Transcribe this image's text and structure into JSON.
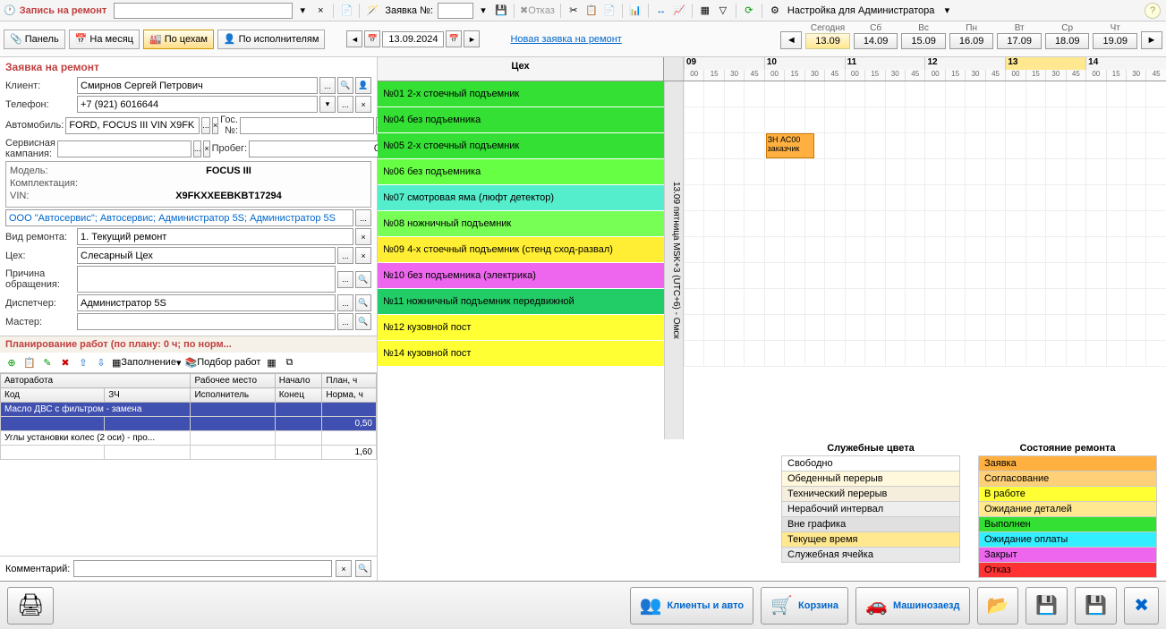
{
  "app": {
    "title": "Запись на ремонт"
  },
  "toolbar": {
    "request_label": "Заявка №:",
    "refusal": "Отказ",
    "admin_setting": "Настройка для Администратора"
  },
  "tabs": {
    "panel": "Панель",
    "month": "На месяц",
    "workshops": "По цехам",
    "performers": "По исполнителям"
  },
  "date_nav": {
    "date": "13.09.2024"
  },
  "new_request_link": "Новая заявка на ремонт",
  "week": {
    "today_label": "Сегодня",
    "days": [
      {
        "label": "Сегодня",
        "date": "13.09",
        "today": true
      },
      {
        "label": "Сб",
        "date": "14.09"
      },
      {
        "label": "Вс",
        "date": "15.09"
      },
      {
        "label": "Пн",
        "date": "16.09"
      },
      {
        "label": "Вт",
        "date": "17.09"
      },
      {
        "label": "Ср",
        "date": "18.09"
      },
      {
        "label": "Чт",
        "date": "19.09"
      }
    ]
  },
  "form": {
    "section_title": "Заявка на ремонт",
    "client_label": "Клиент:",
    "client": "Смирнов Сергей Петрович",
    "phone_label": "Телефон:",
    "phone": "+7 (921) 6016644",
    "auto_label": "Автомобиль:",
    "auto": "FORD, FOCUS III VIN X9FK",
    "gosno_label": "Гос. №:",
    "gosno": "",
    "campaign_label": "Сервисная кампания:",
    "campaign": "",
    "mileage_label": "Пробег:",
    "mileage": "0",
    "model_label": "Модель:",
    "model": "FOCUS III",
    "equip_label": "Комплектация:",
    "vin_label": "VIN:",
    "vin": "X9FKXXEEBKBT17294",
    "org": "ООО \"Автосервис\"; Автосервис; Администратор 5S; Администратор 5S",
    "repair_type_label": "Вид ремонта:",
    "repair_type": "1. Текущий ремонт",
    "workshop_label": "Цех:",
    "workshop": "Слесарный Цех",
    "reason_label": "Причина обращения:",
    "reason": "",
    "dispatcher_label": "Диспетчер:",
    "dispatcher": "Администратор 5S",
    "master_label": "Мастер:",
    "master": ""
  },
  "planning": {
    "header": "Планирование работ   (по плану: 0 ч; по норм...",
    "fill_label": "Заполнение",
    "selection_label": "Подбор работ",
    "columns": {
      "work": "Авторабота",
      "place": "Рабочее место",
      "start": "Начало",
      "plan": "План, ч",
      "code": "Код",
      "zch": "ЗЧ",
      "performer": "Исполнитель",
      "end": "Конец",
      "norm": "Норма, ч"
    },
    "rows": [
      {
        "name": "Масло ДВС с фильтром - замена",
        "norm": "0,50",
        "selected": true
      },
      {
        "name": "Углы установки колес (2 оси) - про...",
        "norm": "1,60",
        "selected": false
      }
    ]
  },
  "comment": {
    "label": "Комментарий:",
    "value": ""
  },
  "schedule": {
    "header": "Цех",
    "date_strip": "13.09 пятница MSK+3 (UTC+6) - Омск",
    "hours": [
      "09",
      "10",
      "11",
      "12",
      "13",
      "14"
    ],
    "minutes": [
      "00",
      "15",
      "30",
      "45"
    ],
    "workshops": [
      {
        "name": "№01  2-х стоечный подъемник",
        "color": "#33e033"
      },
      {
        "name": "№04  без подъемника",
        "color": "#33e033"
      },
      {
        "name": "№05  2-х стоечный подъемник",
        "color": "#33e033"
      },
      {
        "name": "№06  без подъемника",
        "color": "#66ff44"
      },
      {
        "name": "№07  смотровая яма (люфт детектор)",
        "color": "#55eecc"
      },
      {
        "name": "№08  ножничный подъемник",
        "color": "#77ff55"
      },
      {
        "name": "№09  4-х стоечный подъемник (стенд сход-развал)",
        "color": "#ffee33"
      },
      {
        "name": "№10 без подъемника (электрика)",
        "color": "#ee66ee"
      },
      {
        "name": "№11 ножничный подъемник передвижной",
        "color": "#22cc66"
      },
      {
        "name": "№12 кузовной пост",
        "color": "#ffff33"
      },
      {
        "name": "№14 кузовной пост",
        "color": "#ffff33"
      }
    ],
    "appointment": {
      "line1": "ЗН АС00",
      "line2": "заказчик"
    }
  },
  "legend": {
    "service_title": "Служебные цвета",
    "status_title": "Состояние ремонта",
    "service": [
      {
        "name": "Свободно",
        "color": "#ffffff"
      },
      {
        "name": "Обеденный перерыв",
        "color": "#fff8dd"
      },
      {
        "name": "Технический перерыв",
        "color": "#f5eedd"
      },
      {
        "name": "Нерабочий интервал",
        "color": "#eeeeee"
      },
      {
        "name": "Вне графика",
        "color": "#e0e0e0"
      },
      {
        "name": "Текущее время",
        "color": "#ffe890"
      },
      {
        "name": "Служебная ячейка",
        "color": "#e8e8e8"
      }
    ],
    "status": [
      {
        "name": "Заявка",
        "color": "#ffb040"
      },
      {
        "name": "Согласование",
        "color": "#ffd077"
      },
      {
        "name": "В работе",
        "color": "#ffff33"
      },
      {
        "name": "Ожидание деталей",
        "color": "#ffe890"
      },
      {
        "name": "Выполнен",
        "color": "#33e033"
      },
      {
        "name": "Ожидание оплаты",
        "color": "#33eeff"
      },
      {
        "name": "Закрыт",
        "color": "#ee66ee"
      },
      {
        "name": "Отказ",
        "color": "#ff3333"
      }
    ]
  },
  "bottom": {
    "clients": "Клиенты и авто",
    "cart": "Корзина",
    "drive_in": "Машинозаезд"
  }
}
